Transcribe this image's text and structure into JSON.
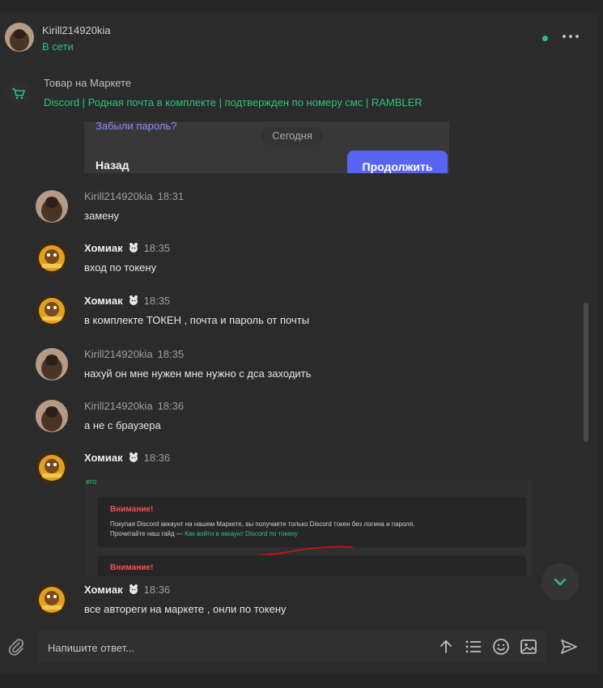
{
  "header": {
    "name": "Kirill214920kia",
    "status": "В сети"
  },
  "product": {
    "label": "Товар на Маркете",
    "title": "Discord | Родная почта в комплекте | подтвержден по номеру смс | RAMBLER"
  },
  "snippet": {
    "forgot": "Забыли пароль?",
    "date_chip": "Сегодня",
    "back": "Назад",
    "continue": "Продолжить"
  },
  "messages": [
    {
      "author": "Kirill214920kia",
      "time": "18:31",
      "text": "замену"
    },
    {
      "author": "Хомиак",
      "time": "18:35",
      "text": "вход по токену"
    },
    {
      "author": "Хомиак",
      "time": "18:35",
      "text": "в комплекте ТОКЕН , почта и пароль от почты"
    },
    {
      "author": "Kirill214920kia",
      "time": "18:35",
      "text": "нахуй он мне нужен мне нужно с дса заходить"
    },
    {
      "author": "Kirill214920kia",
      "time": "18:36",
      "text": "а не с браузера"
    },
    {
      "author": "Хомиак",
      "time": "18:36",
      "text": ""
    },
    {
      "author": "Хомиак",
      "time": "18:36",
      "text": "все автореги на маркете , онли по токену"
    }
  ],
  "attachment": {
    "green_bit": "его",
    "warning_title": "Внимание!",
    "warning_line1": "Покупая Discord аккаунт на нашем Маркете, вы получаете только Discord токен без логина и пароля.",
    "warning_line2_prefix": "Прочитайте наш гайд — ",
    "warning_link": "Как войти в аккаунт Discord по токену",
    "warning_title2": "Внимание!"
  },
  "composer": {
    "placeholder": "Напишите ответ..."
  },
  "colors": {
    "accent_green": "#2ec27e",
    "warning_red": "#ff4d4d",
    "discord_blurple": "#5865f2"
  }
}
